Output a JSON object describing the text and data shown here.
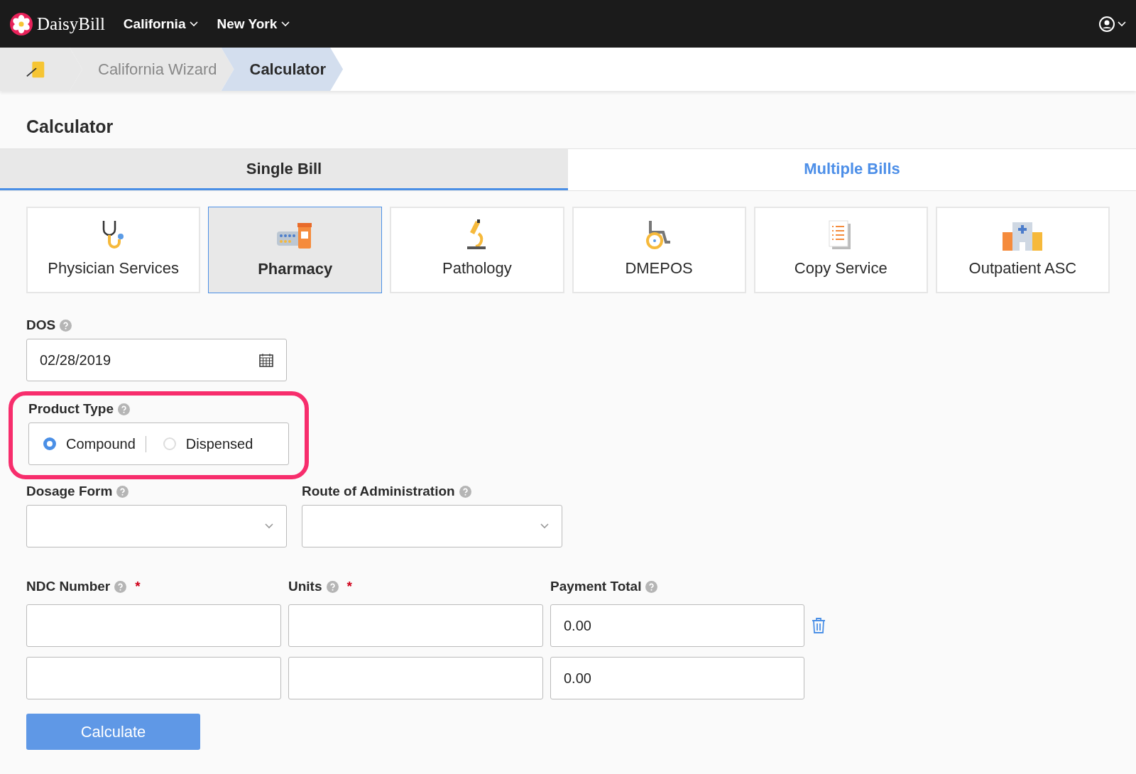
{
  "nav": {
    "logo": "DaisyBill",
    "menus": [
      "California",
      "New York"
    ]
  },
  "breadcrumbs": [
    {
      "label": "California Wizard",
      "selected": false
    },
    {
      "label": "Calculator",
      "selected": true
    }
  ],
  "page_title": "Calculator",
  "tabs": [
    {
      "label": "Single Bill",
      "selected": true
    },
    {
      "label": "Multiple Bills",
      "selected": false
    }
  ],
  "services": [
    {
      "label": "Physician Services",
      "kind": "stethoscope",
      "selected": false
    },
    {
      "label": "Pharmacy",
      "kind": "pills",
      "selected": true
    },
    {
      "label": "Pathology",
      "kind": "microscope",
      "selected": false
    },
    {
      "label": "DMEPOS",
      "kind": "wheelchair",
      "selected": false
    },
    {
      "label": "Copy Service",
      "kind": "document",
      "selected": false
    },
    {
      "label": "Outpatient ASC",
      "kind": "hospital",
      "selected": false
    }
  ],
  "dos": {
    "label": "DOS",
    "value": "02/28/2019"
  },
  "product_type": {
    "label": "Product Type",
    "options": [
      {
        "label": "Compound",
        "selected": true
      },
      {
        "label": "Dispensed",
        "selected": false
      }
    ]
  },
  "selects": [
    {
      "label": "Dosage Form"
    },
    {
      "label": "Route of Administration"
    }
  ],
  "line_columns": [
    {
      "label": "NDC Number",
      "required": "*"
    },
    {
      "label": "Units",
      "required": "*"
    },
    {
      "label": "Payment Total"
    }
  ],
  "lines": [
    {
      "total": "0.00",
      "deletable": true
    },
    {
      "total": "0.00",
      "deletable": false
    }
  ],
  "calculate_button": "Calculate"
}
